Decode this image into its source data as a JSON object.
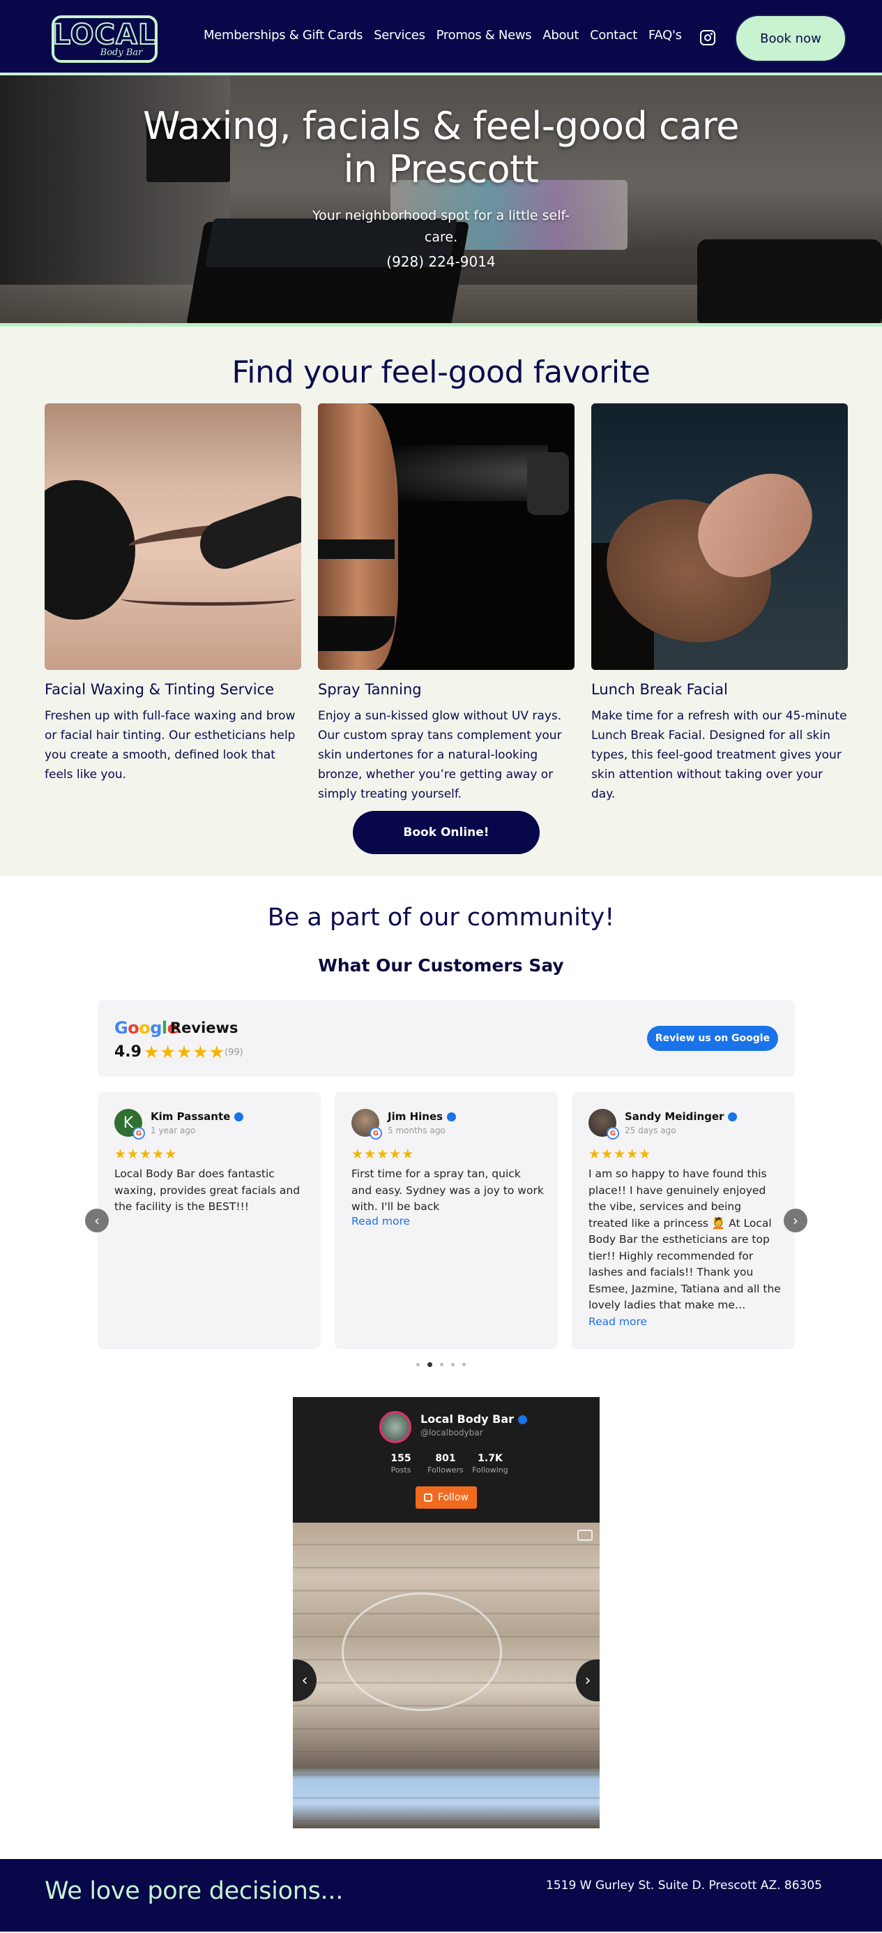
{
  "header": {
    "logo_text": "LOCAL",
    "logo_sub": "Body Bar",
    "nav": [
      "Memberships & Gift Cards",
      "Services",
      "Promos & News",
      "About",
      "Contact",
      "FAQ's"
    ],
    "cta": "Book now",
    "colors": {
      "navy": "#07074a",
      "mint": "#c8f2d0"
    }
  },
  "hero": {
    "title": "Waxing, facials & feel-good care in Prescott",
    "subtitle": "Your neighborhood spot for a little self-care.",
    "phone": "(928) 224-9014"
  },
  "services": {
    "heading": "Find your feel-good favorite",
    "cards": [
      {
        "title": "Facial Waxing & Tinting Service",
        "text": "Freshen up with full-face waxing and brow or facial hair tinting. Our estheticians help you create a smooth, defined look that feels like you."
      },
      {
        "title": "Spray Tanning",
        "text": "Enjoy a sun-kissed glow without UV rays. Our custom spray tans complement your skin undertones for a natural-looking bronze, whether you’re getting away or simply treating yourself."
      },
      {
        "title": "Lunch Break Facial",
        "text": "Make time for a refresh with our 45-minute Lunch Break Facial. Designed for all skin types, this feel-good treatment gives your skin attention without taking over your day."
      }
    ],
    "cta": "Book Online!"
  },
  "community": {
    "heading": "Be a part of our community!",
    "subheading": "What Our Customers Say",
    "reviews_widget": {
      "brand": "Google",
      "label": "Reviews",
      "rating": "4.9",
      "stars": "★★★★★",
      "count": "(99)",
      "cta": "Review us on Google"
    },
    "reviews": [
      {
        "name": "Kim Passante",
        "initial": "K",
        "time": "1 year ago",
        "stars": "★★★★★",
        "text": "Local Body Bar does fantastic waxing, provides great facials and the facility is the BEST!!!",
        "read_more": ""
      },
      {
        "name": "Jim Hines",
        "initial": "",
        "time": "5 months ago",
        "stars": "★★★★★",
        "text": "First time for a spray tan, quick and easy. Sydney was a joy to work with. I'll be back",
        "read_more": "Read more"
      },
      {
        "name": "Sandy Meidinger",
        "initial": "",
        "time": "25 days ago",
        "stars": "★★★★★",
        "text": "I am so happy to have found this place!! I have genuinely enjoyed the vibe, services and being treated like a princess 💆 At Local Body Bar the estheticians are top tier!! Highly recommended for lashes and facials!! Thank you Esmee, Jazmine, Tatiana and all the lovely ladies that make me…",
        "read_more": "Read more"
      }
    ],
    "carousel": {
      "prev": "‹",
      "next": "›",
      "page": 2,
      "pages": 5
    }
  },
  "instagram": {
    "name": "Local Body Bar",
    "handle": "@localbodybar",
    "stats": [
      {
        "value": "155",
        "label": "Posts"
      },
      {
        "value": "801",
        "label": "Followers"
      },
      {
        "value": "1.7K",
        "label": "Following"
      }
    ],
    "follow": "Follow",
    "prev": "‹",
    "next": "›"
  },
  "footer": {
    "tagline": "We love pore decisions...",
    "address": "1519 W Gurley St. Suite D. Prescott AZ. 86305"
  }
}
